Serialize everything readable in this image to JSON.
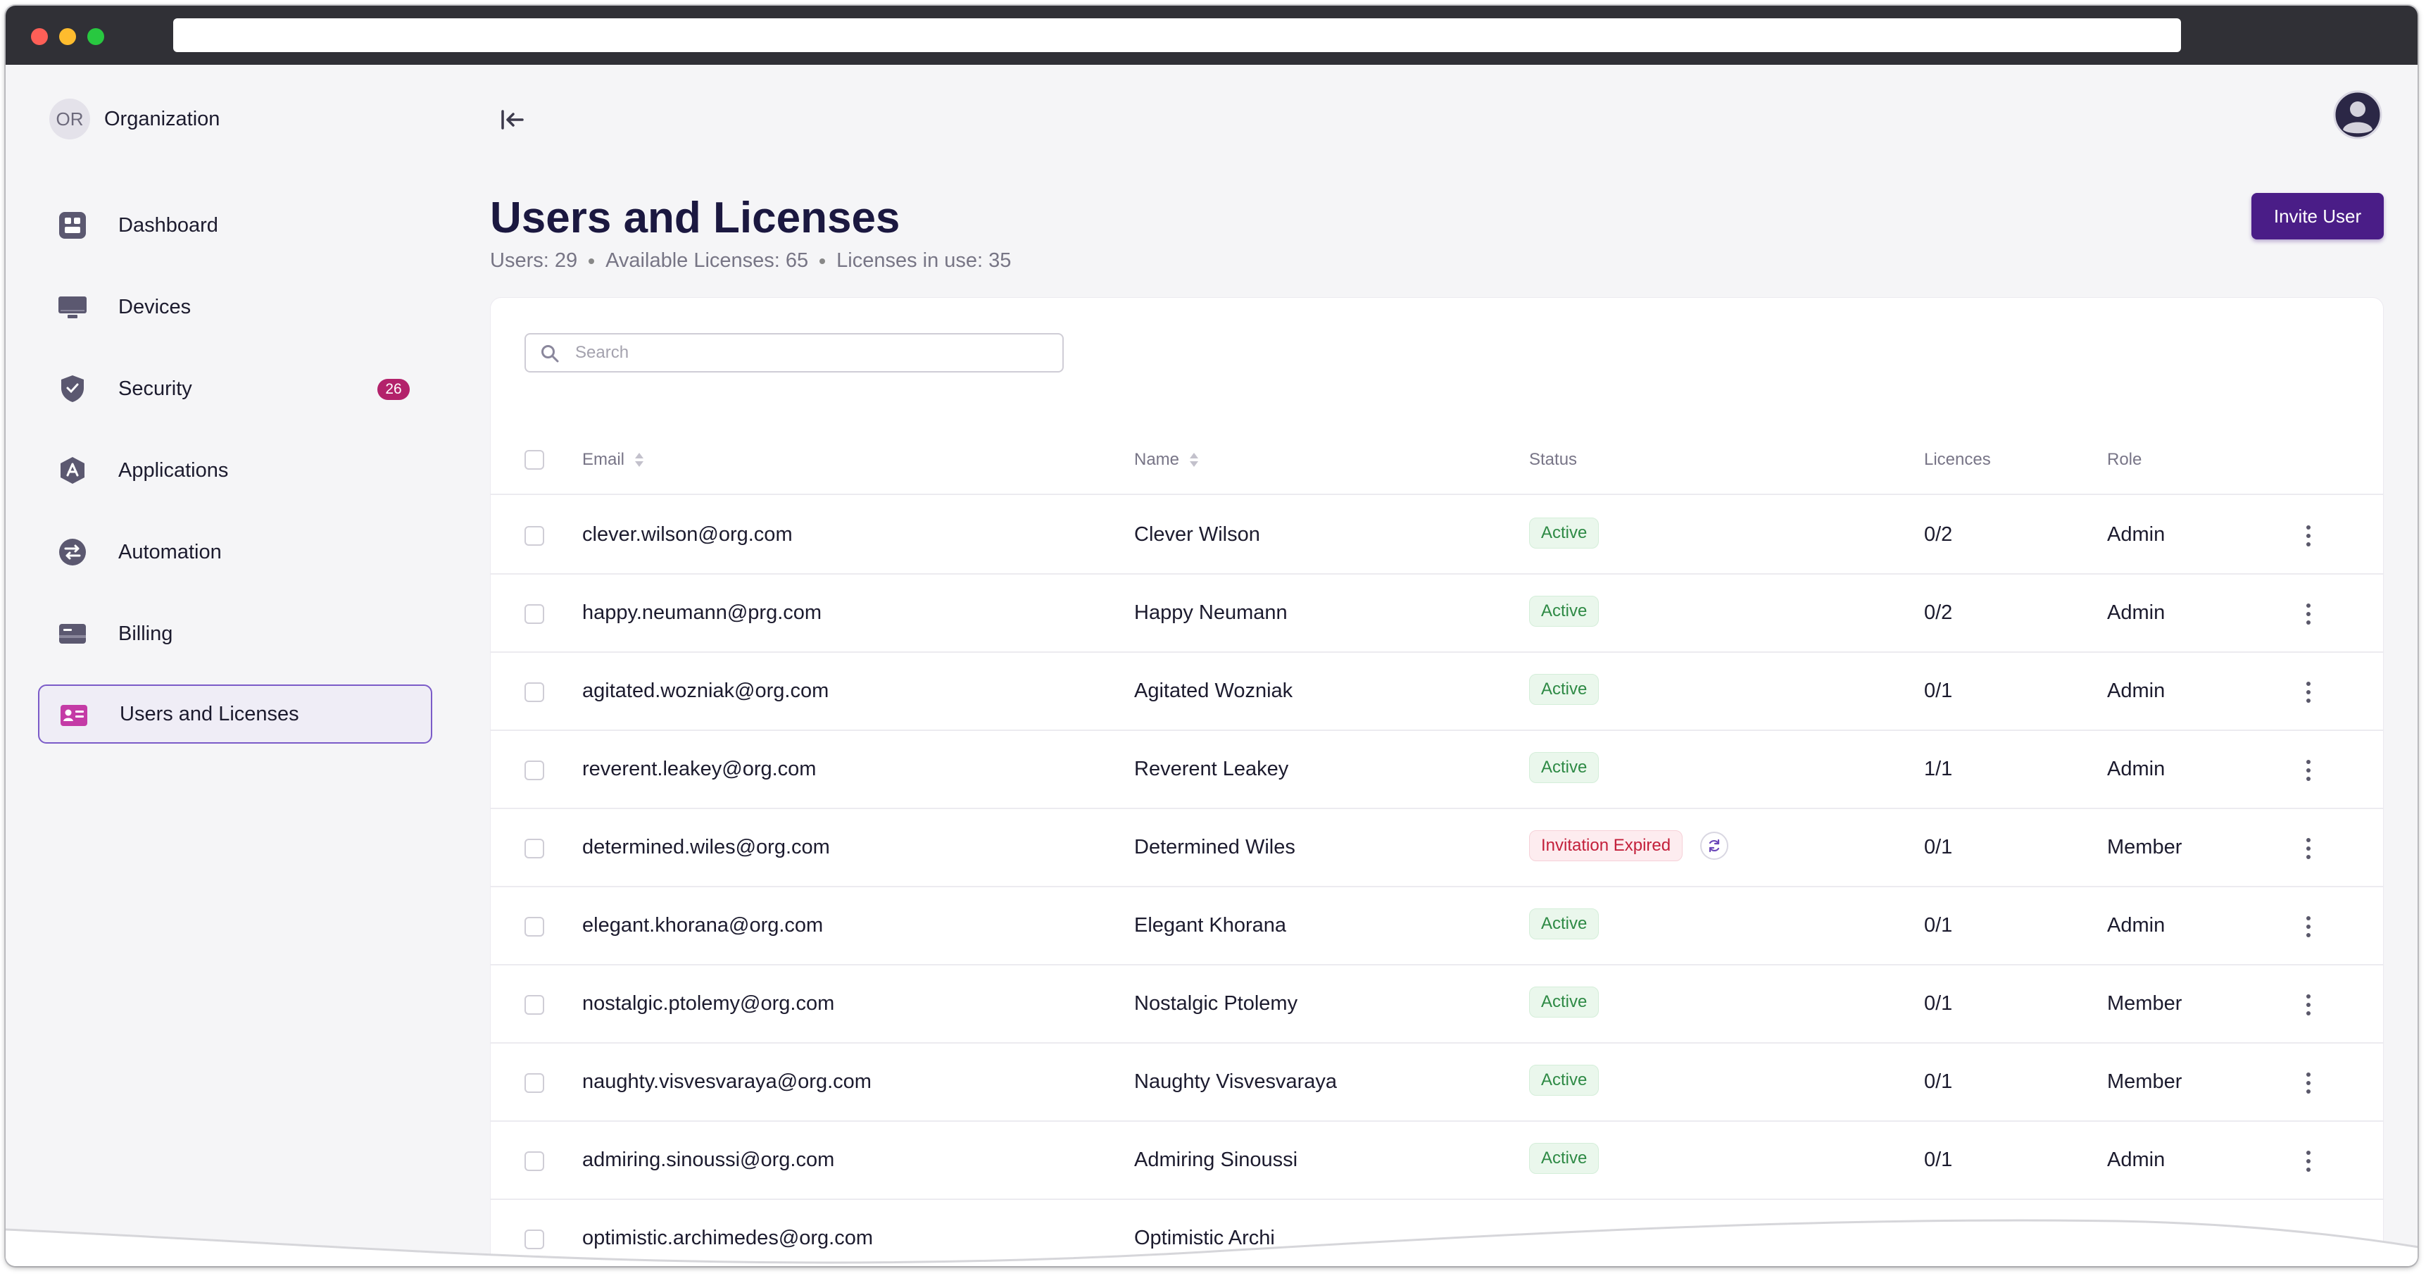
{
  "sidebar": {
    "org_initials": "OR",
    "org_name": "Organization",
    "items": [
      {
        "label": "Dashboard",
        "icon": "dashboard-icon"
      },
      {
        "label": "Devices",
        "icon": "monitor-icon"
      },
      {
        "label": "Security",
        "icon": "shield-icon",
        "badge": "26"
      },
      {
        "label": "Applications",
        "icon": "applications-icon"
      },
      {
        "label": "Automation",
        "icon": "automation-icon"
      },
      {
        "label": "Billing",
        "icon": "billing-card-icon"
      },
      {
        "label": "Users and Licenses",
        "icon": "user-card-icon",
        "active": true
      }
    ]
  },
  "header": {
    "title": "Users and Licenses",
    "meta": [
      "Users: 29",
      "Available Licenses: 65",
      "Licenses in use: 35"
    ],
    "invite_label": "Invite User"
  },
  "search": {
    "placeholder": "Search",
    "value": ""
  },
  "table": {
    "columns": {
      "email": "Email",
      "name": "Name",
      "status": "Status",
      "licences": "Licences",
      "role": "Role"
    },
    "rows": [
      {
        "email": "clever.wilson@org.com",
        "name": "Clever Wilson",
        "status": "Active",
        "licences": "0/2",
        "role": "Admin"
      },
      {
        "email": "happy.neumann@prg.com",
        "name": "Happy Neumann",
        "status": "Active",
        "licences": "0/2",
        "role": "Admin"
      },
      {
        "email": "agitated.wozniak@org.com",
        "name": "Agitated Wozniak",
        "status": "Active",
        "licences": "0/1",
        "role": "Admin"
      },
      {
        "email": "reverent.leakey@org.com",
        "name": "Reverent Leakey",
        "status": "Active",
        "licences": "1/1",
        "role": "Admin"
      },
      {
        "email": "determined.wiles@org.com",
        "name": "Determined Wiles",
        "status": "Invitation Expired",
        "licences": "0/1",
        "role": "Member"
      },
      {
        "email": "elegant.khorana@org.com",
        "name": "Elegant Khorana",
        "status": "Active",
        "licences": "0/1",
        "role": "Admin"
      },
      {
        "email": "nostalgic.ptolemy@org.com",
        "name": "Nostalgic Ptolemy",
        "status": "Active",
        "licences": "0/1",
        "role": "Member"
      },
      {
        "email": "naughty.visvesvaraya@org.com",
        "name": "Naughty Visvesvaraya",
        "status": "Active",
        "licences": "0/1",
        "role": "Member"
      },
      {
        "email": "admiring.sinoussi@org.com",
        "name": "Admiring Sinoussi",
        "status": "Active",
        "licences": "0/1",
        "role": "Admin"
      },
      {
        "email": "optimistic.archimedes@org.com",
        "name": "Optimistic Archi",
        "status": "",
        "licences": "",
        "role": ""
      }
    ]
  },
  "colors": {
    "brand": "#4a1d87",
    "active_status": "#2e8a45",
    "expired_status": "#c3203b",
    "badge": "#b3226b",
    "nav_active_border": "#7b5bc8"
  }
}
